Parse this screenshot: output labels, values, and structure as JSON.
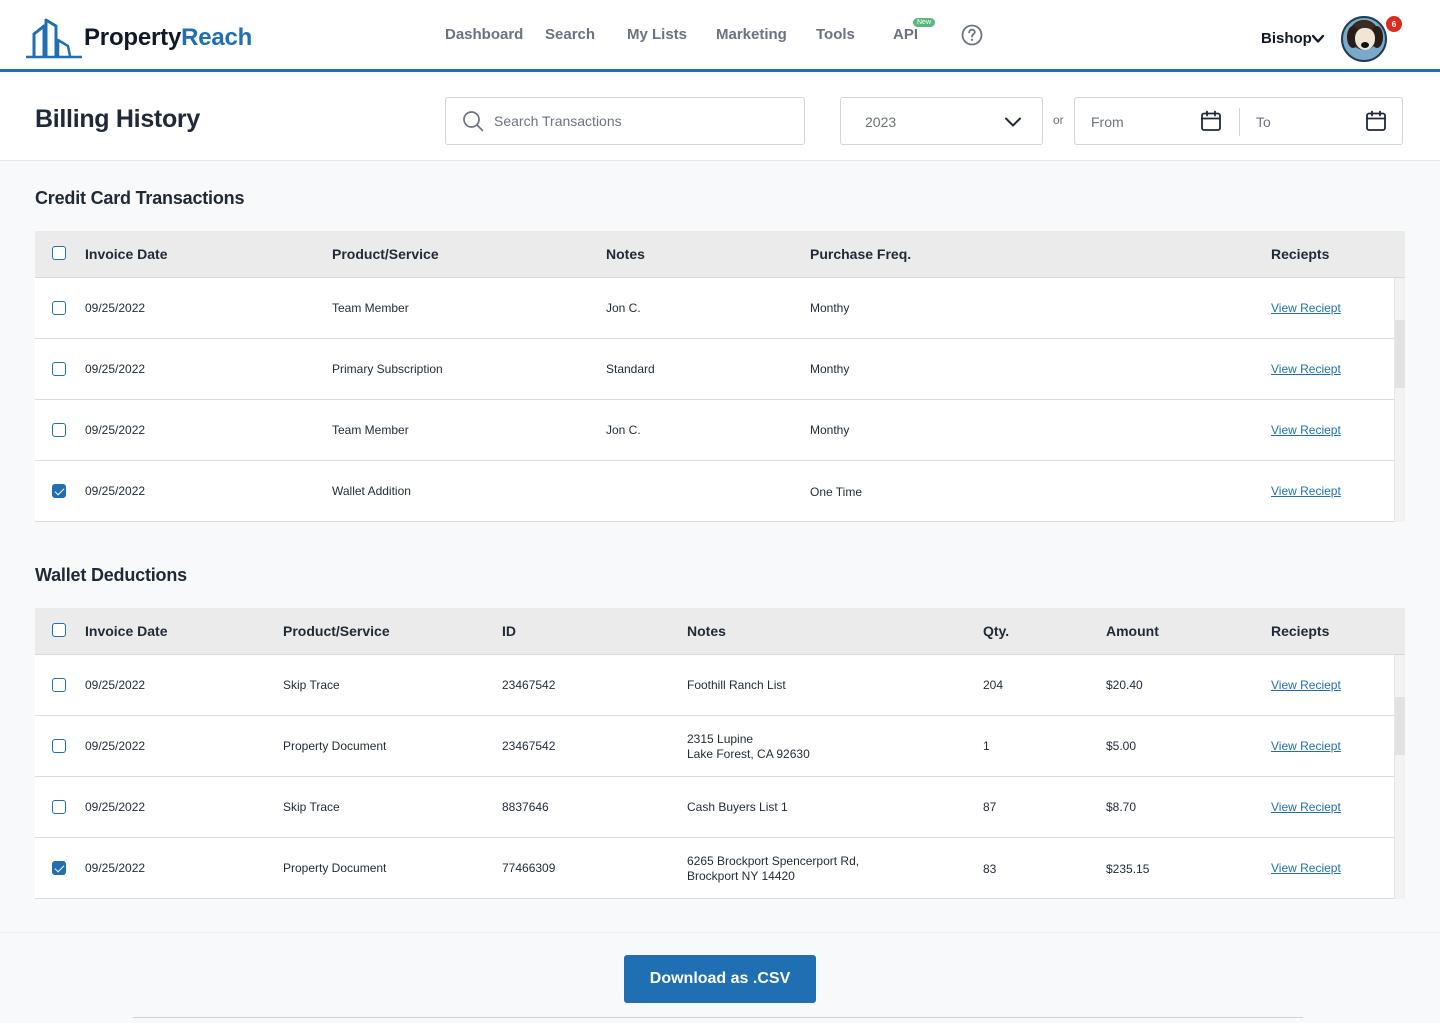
{
  "brand": {
    "part1": "Property",
    "part2": "Reach"
  },
  "nav": {
    "items": [
      "Dashboard",
      "Search",
      "My Lists",
      "Marketing",
      "Tools",
      "API"
    ],
    "api_badge": "New"
  },
  "user": {
    "name": "Bishop",
    "notifications": "6"
  },
  "header": {
    "title": "Billing History",
    "search_placeholder": "Search Transactions",
    "year": "2023",
    "or": "or",
    "from_label": "From",
    "to_label": "To"
  },
  "credit": {
    "title": "Credit Card Transactions",
    "columns": [
      "Invoice Date",
      "Product/Service",
      "Notes",
      "Purchase Freq.",
      "Reciepts"
    ],
    "rows": [
      {
        "date": "09/25/2022",
        "product": "Team Member",
        "notes": "Jon C.",
        "freq": "Monthy",
        "receipt": "View Reciept",
        "checked": false
      },
      {
        "date": "09/25/2022",
        "product": "Primary Subscription",
        "notes": "Standard",
        "freq": "Monthy",
        "receipt": "View Reciept",
        "checked": false
      },
      {
        "date": "09/25/2022",
        "product": "Team Member",
        "notes": "Jon C.",
        "freq": "Monthy",
        "receipt": "View Reciept",
        "checked": false
      },
      {
        "date": "09/25/2022",
        "product": "Wallet Addition",
        "notes": "",
        "freq": "One Time",
        "receipt": "View Reciept",
        "checked": true
      }
    ]
  },
  "wallet": {
    "title": "Wallet Deductions",
    "columns": [
      "Invoice Date",
      "Product/Service",
      "ID",
      "Notes",
      "Qty.",
      "Amount",
      "Reciepts"
    ],
    "rows": [
      {
        "date": "09/25/2022",
        "product": "Skip Trace",
        "id": "23467542",
        "notes1": "Foothill Ranch List",
        "notes2": "",
        "qty": "204",
        "amount": "$20.40",
        "receipt": "View Reciept",
        "checked": false
      },
      {
        "date": "09/25/2022",
        "product": "Property Document",
        "id": "23467542",
        "notes1": "2315 Lupine",
        "notes2": "Lake Forest, CA 92630",
        "qty": "1",
        "amount": "$5.00",
        "receipt": "View Reciept",
        "checked": false
      },
      {
        "date": "09/25/2022",
        "product": "Skip Trace",
        "id": "8837646",
        "notes1": "Cash Buyers List 1",
        "notes2": "",
        "qty": "87",
        "amount": "$8.70",
        "receipt": "View Reciept",
        "checked": false
      },
      {
        "date": "09/25/2022",
        "product": "Property Document",
        "id": "77466309",
        "notes1": "6265 Brockport Spencerport Rd,",
        "notes2": "Brockport NY 14420",
        "qty": "83",
        "amount": "$235.15",
        "receipt": "View Reciept",
        "checked": true
      }
    ]
  },
  "footer": {
    "button": "Download as .CSV"
  },
  "colors": {
    "primary": "#1f6fb2",
    "badge_red": "#d92d20",
    "new_green": "#56b87b",
    "header_gray": "#ebebeb"
  }
}
